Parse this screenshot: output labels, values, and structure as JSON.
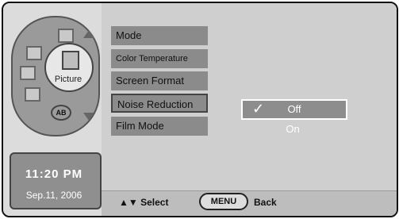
{
  "sidebar": {
    "picture_label": "Picture",
    "ab_label": "AB",
    "time": "11:20 PM",
    "date": "Sep.11, 2006"
  },
  "menu": {
    "items": [
      {
        "label": "Mode"
      },
      {
        "label": "Color Temperature"
      },
      {
        "label": "Screen Format"
      },
      {
        "label": "Noise Reduction"
      },
      {
        "label": "Film Mode"
      }
    ]
  },
  "options": {
    "selected": "Off",
    "items": [
      {
        "label": "Off"
      },
      {
        "label": "On"
      }
    ],
    "checkmark": "✓"
  },
  "footer": {
    "select_hint": "▲▼ Select",
    "menu_button": "MENU",
    "back_label": "Back"
  }
}
